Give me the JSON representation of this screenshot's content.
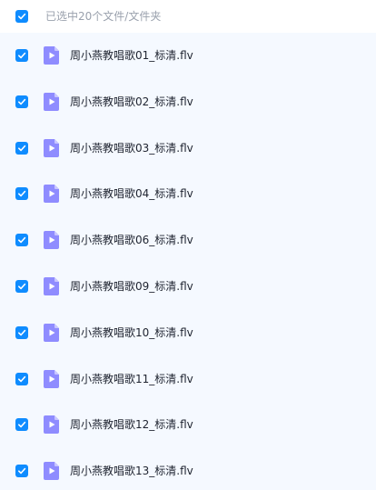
{
  "header": {
    "select_all_checked": true,
    "selection_text": "已选中20个文件/文件夹"
  },
  "colors": {
    "accent": "#0f8cff",
    "row_background": "#f5f9ff",
    "video_icon": "#8f8cff"
  },
  "files": [
    {
      "name": "周小燕教唱歌01_标清.flv",
      "checked": true,
      "icon": "video-file-icon"
    },
    {
      "name": "周小燕教唱歌02_标清.flv",
      "checked": true,
      "icon": "video-file-icon"
    },
    {
      "name": "周小燕教唱歌03_标清.flv",
      "checked": true,
      "icon": "video-file-icon"
    },
    {
      "name": "周小燕教唱歌04_标清.flv",
      "checked": true,
      "icon": "video-file-icon"
    },
    {
      "name": "周小燕教唱歌06_标清.flv",
      "checked": true,
      "icon": "video-file-icon"
    },
    {
      "name": "周小燕教唱歌09_标清.flv",
      "checked": true,
      "icon": "video-file-icon"
    },
    {
      "name": "周小燕教唱歌10_标清.flv",
      "checked": true,
      "icon": "video-file-icon"
    },
    {
      "name": "周小燕教唱歌11_标清.flv",
      "checked": true,
      "icon": "video-file-icon"
    },
    {
      "name": "周小燕教唱歌12_标清.flv",
      "checked": true,
      "icon": "video-file-icon"
    },
    {
      "name": "周小燕教唱歌13_标清.flv",
      "checked": true,
      "icon": "video-file-icon"
    }
  ]
}
